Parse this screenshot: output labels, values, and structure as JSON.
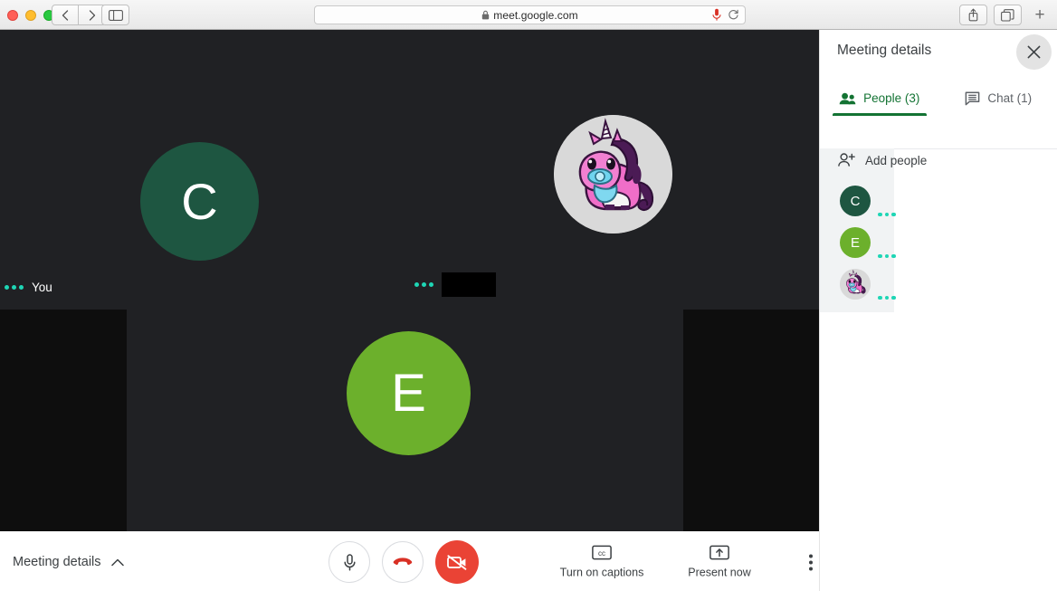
{
  "browser": {
    "url": "meet.google.com",
    "lock_icon": "lock-icon",
    "back_label": "‹",
    "forward_label": "›",
    "mic_icon": "microphone-icon",
    "reload_icon": "reload-icon",
    "share_icon": "share-icon",
    "tabs_icon": "tab-overview-icon",
    "new_tab_label": "+"
  },
  "stage": {
    "tiles": [
      {
        "name": "You",
        "initial": "C",
        "avatar_color": "#1e5641",
        "type": "initial",
        "redacted": false
      },
      {
        "name": "",
        "initial": "",
        "avatar_color": "#d8d8d8",
        "type": "image",
        "image": "unicorn-avatar",
        "redacted": true
      },
      {
        "name": "",
        "initial": "E",
        "avatar_color": "#6cb02c",
        "type": "initial",
        "redacted": false
      }
    ],
    "you_label": "You"
  },
  "bottom_bar": {
    "meeting_details_label": "Meeting details",
    "chevron_icon": "chevron-up-icon",
    "controls": [
      {
        "icon": "microphone-icon",
        "state": "on"
      },
      {
        "icon": "hangup-icon",
        "state": "leave"
      },
      {
        "icon": "camera-off-icon",
        "state": "off"
      }
    ],
    "captions_label": "Turn on captions",
    "captions_icon": "closed-caption-icon",
    "present_label": "Present now",
    "present_icon": "present-screen-icon",
    "more_icon": "more-vertical-icon"
  },
  "panel": {
    "title": "Meeting details",
    "close_icon": "close-icon",
    "tabs": [
      {
        "label": "People (3)",
        "icon": "people-icon",
        "active": true
      },
      {
        "label": "Chat (1)",
        "icon": "chat-icon",
        "active": false
      }
    ],
    "add_people_label": "Add people",
    "add_people_icon": "person-add-icon",
    "people": [
      {
        "initial": "C",
        "color": "#1e5641",
        "type": "initial"
      },
      {
        "initial": "E",
        "color": "#6cb02c",
        "type": "initial"
      },
      {
        "initial": "",
        "color": "#d8d8d8",
        "type": "image",
        "image": "unicorn-avatar"
      }
    ]
  },
  "colors": {
    "stage_bg": "#202124",
    "tile_dark": "#0e0e0e",
    "accent_green": "#137333",
    "mic_teal": "#1ed6b5",
    "danger_red": "#ea4335",
    "panel_list_bg": "#f1f3f4"
  }
}
